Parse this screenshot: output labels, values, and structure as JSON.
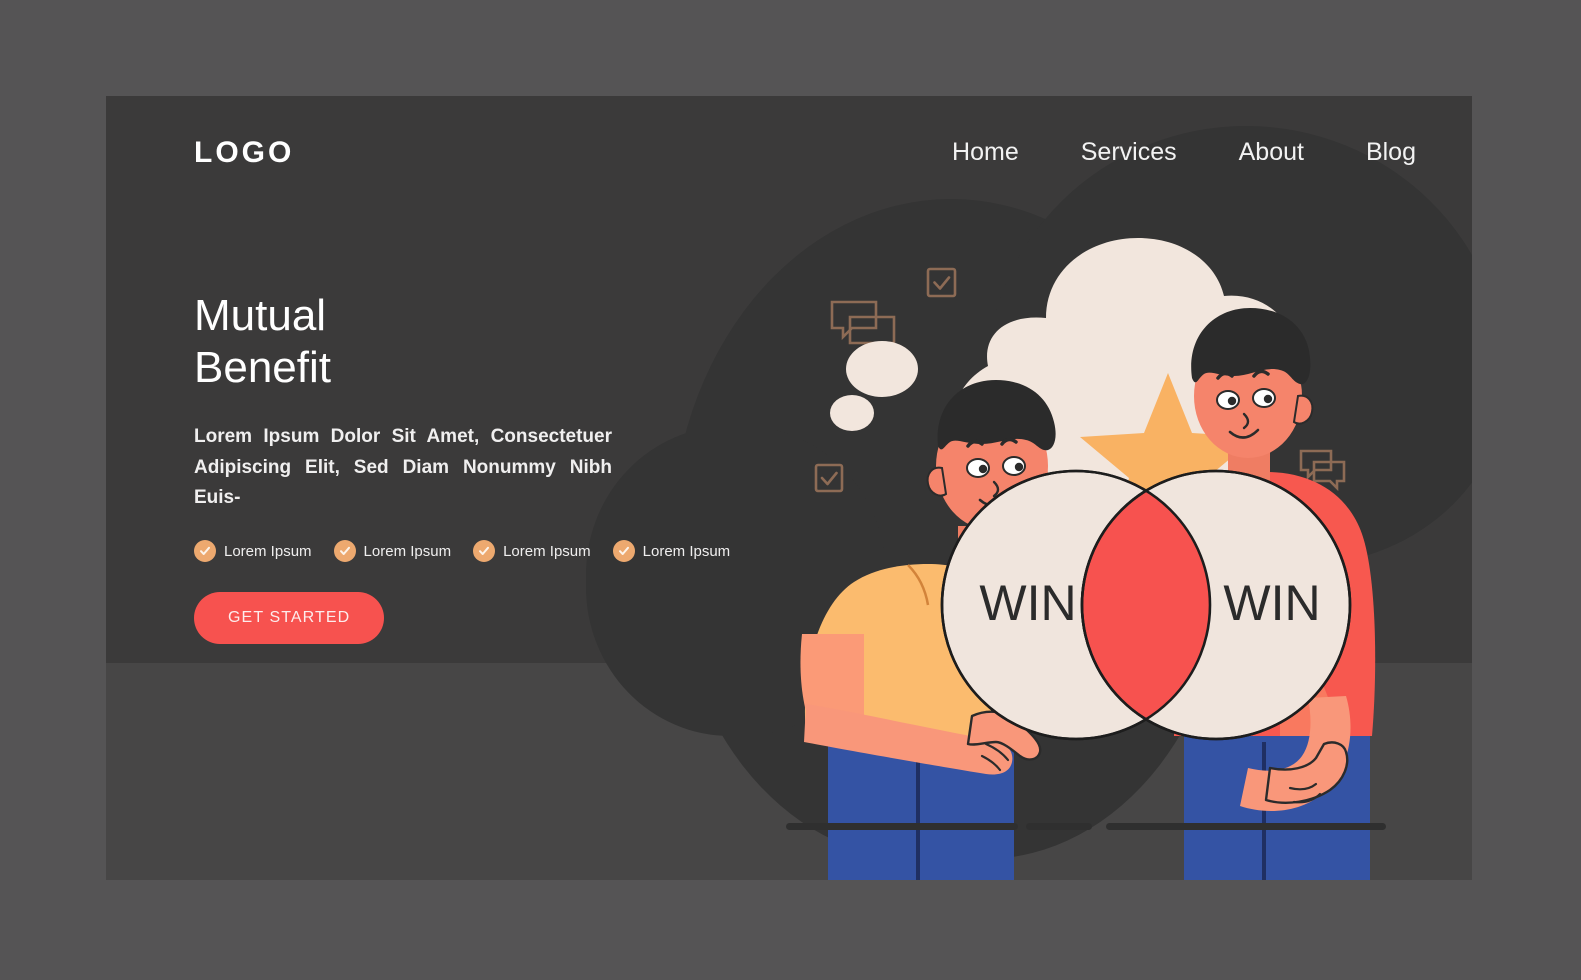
{
  "page": {
    "background_color": "#555455",
    "panel_color": "#3b3a3a",
    "panel_lower_band_color": "#474646",
    "accent_color": "#f7524f",
    "secondary_accent_color": "#f9b263",
    "check_badge_color": "#eda96f"
  },
  "header": {
    "logo": "LOGO",
    "nav": [
      {
        "label": "Home"
      },
      {
        "label": "Services"
      },
      {
        "label": "About"
      },
      {
        "label": "Blog"
      }
    ]
  },
  "hero": {
    "heading": "Mutual\nBenefit",
    "subtext": "Lorem Ipsum Dolor Sit Amet, Consectetuer Adipiscing Elit, Sed Diam Nonummy Nibh Euis-",
    "features": [
      {
        "label": "Lorem Ipsum"
      },
      {
        "label": "Lorem Ipsum"
      },
      {
        "label": "Lorem Ipsum"
      },
      {
        "label": "Lorem Ipsum"
      }
    ],
    "cta_label": "GET STARTED"
  },
  "illustration": {
    "alt": "Two men holding overlapping WIN circles beneath a thought bubble with a star",
    "circle_left_label": "WIN",
    "circle_right_label": "WIN",
    "overlap_color": "#f7524f",
    "circle_color": "#f0e5dd",
    "thought_bubble_color": "#f2e6dd",
    "star_color": "#f9b263",
    "left_person_shirt_color": "#fbbb6e",
    "right_person_shirt_color": "#f7584f",
    "pants_color": "#3453a4",
    "skin_color": "#f5846b",
    "hair_color": "#2b2b2b",
    "deco_icon_color": "#8d6b55",
    "deco_icons": [
      {
        "type": "checkbox-icon"
      },
      {
        "type": "chat-bubbles-icon"
      },
      {
        "type": "checkbox-icon"
      },
      {
        "type": "chat-bubbles-icon"
      },
      {
        "type": "checkbox-icon"
      },
      {
        "type": "chat-bubbles-icon"
      }
    ]
  }
}
